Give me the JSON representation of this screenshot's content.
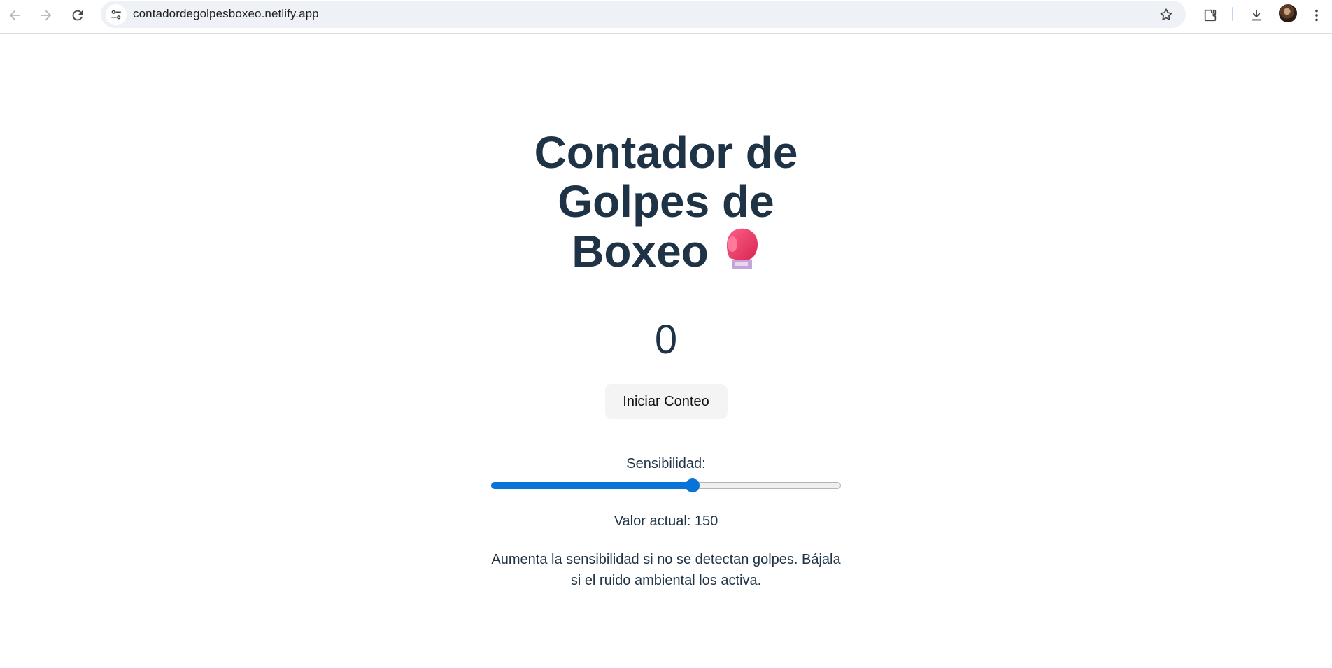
{
  "browser": {
    "url": "contadordegolpesboxeo.netlify.app",
    "icons": [
      "back-arrow-icon",
      "forward-arrow-icon",
      "reload-icon",
      "site-info-icon",
      "bookmark-star-icon",
      "extensions-icon",
      "download-icon",
      "profile-avatar",
      "more-menu-icon"
    ]
  },
  "page": {
    "title": "Contador de Golpes de Boxeo",
    "title_emoji": "boxing-glove-icon",
    "count": "0",
    "start_button": "Iniciar Conteo",
    "sensitivity_label": "Sensibilidad:",
    "sensitivity_level": 0.58,
    "current_value_text": "Valor actual: 150",
    "help_text": "Aumenta la sensibilidad si no se detectan golpes. Bájala si el ruido ambiental los activa."
  },
  "colors": {
    "text": "#1f3346",
    "accent": "#0a74d6",
    "button_bg": "#f4f4f4",
    "glove": "#e8375f"
  }
}
